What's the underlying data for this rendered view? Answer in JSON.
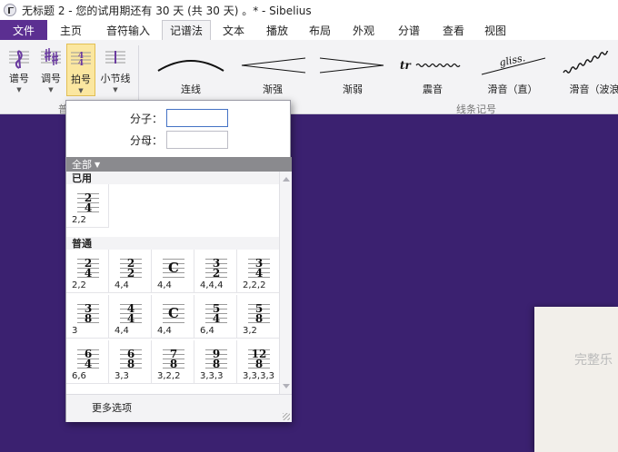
{
  "window": {
    "title": "无标题 2 - 您的试用期还有 30 天 (共 30 天) 。* - Sibelius"
  },
  "tabs": [
    {
      "label": "文件"
    },
    {
      "label": "主页"
    },
    {
      "label": "音符输入"
    },
    {
      "label": "记谱法"
    },
    {
      "label": "文本"
    },
    {
      "label": "播放"
    },
    {
      "label": "布局"
    },
    {
      "label": "外观"
    },
    {
      "label": "分谱"
    },
    {
      "label": "查看"
    },
    {
      "label": "视图"
    }
  ],
  "active_tab": "记谱法",
  "ribbon": {
    "buttons": [
      {
        "label": "谱号",
        "icon": "clef-icon"
      },
      {
        "label": "调号",
        "icon": "key-signature-icon"
      },
      {
        "label": "拍号",
        "icon": "time-signature-icon",
        "selected": true
      },
      {
        "label": "小节线",
        "icon": "barline-icon"
      }
    ],
    "line_items": [
      {
        "label": "连线"
      },
      {
        "label": "渐强"
      },
      {
        "label": "渐弱"
      },
      {
        "label": "震音",
        "glyph": "tr"
      },
      {
        "label": "滑音（直）",
        "glyph": "gliss."
      },
      {
        "label": "滑音（波浪"
      }
    ],
    "group_labels": {
      "left": "普",
      "lines": "线条记号"
    }
  },
  "popup": {
    "numerator_label": "分子：",
    "denominator_label": "分母：",
    "numerator_value": "",
    "denominator_value": "",
    "filter": "全部",
    "sections": {
      "used": "已用",
      "common": "普通"
    },
    "used_items": [
      {
        "top": "2",
        "bottom": "4",
        "label": "2,2"
      }
    ],
    "common_items": [
      {
        "top": "2",
        "bottom": "4",
        "label": "2,2"
      },
      {
        "top": "2",
        "bottom": "2",
        "label": "4,4"
      },
      {
        "top": "C",
        "bottom": "",
        "label": "4,4"
      },
      {
        "top": "3",
        "bottom": "2",
        "label": "4,4,4"
      },
      {
        "top": "3",
        "bottom": "4",
        "label": "2,2,2"
      },
      {
        "top": "3",
        "bottom": "8",
        "label": "3"
      },
      {
        "top": "4",
        "bottom": "4",
        "label": "4,4"
      },
      {
        "top": "C",
        "bottom": "",
        "label": "4,4"
      },
      {
        "top": "5",
        "bottom": "4",
        "label": "6,4"
      },
      {
        "top": "5",
        "bottom": "8",
        "label": "3,2"
      },
      {
        "top": "6",
        "bottom": "4",
        "label": "6,6"
      },
      {
        "top": "6",
        "bottom": "8",
        "label": "3,3"
      },
      {
        "top": "7",
        "bottom": "8",
        "label": "3,2,2"
      },
      {
        "top": "9",
        "bottom": "8",
        "label": "3,3,3"
      },
      {
        "top": "12",
        "bottom": "8",
        "label": "3,3,3,3"
      }
    ],
    "more_options": "更多选项"
  },
  "document": {
    "page_text": "完整乐"
  },
  "colors": {
    "file_tab": "#5b2f91",
    "workspace": "#3b2170",
    "selected_button": "#fbe7a0"
  }
}
